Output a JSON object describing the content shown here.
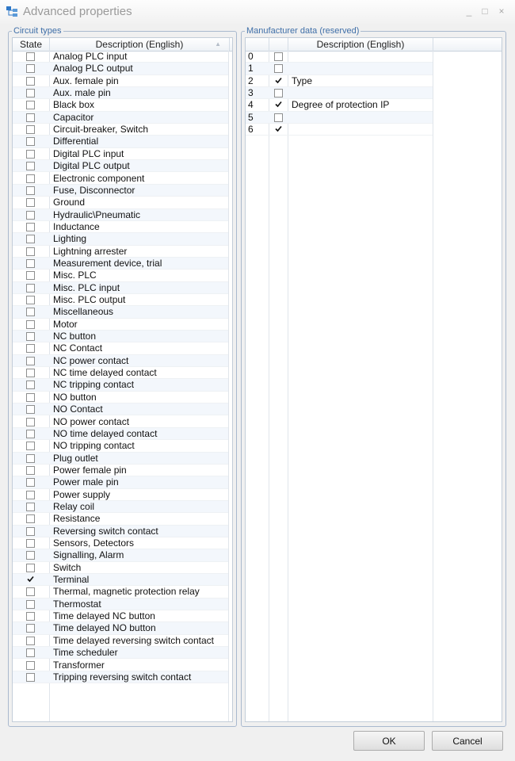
{
  "window": {
    "title": "Advanced properties",
    "minimize_glyph": "_",
    "maximize_glyph": "□",
    "close_glyph": "×"
  },
  "circuit_types": {
    "legend": "Circuit types",
    "col_state": "State",
    "col_description": "Description (English)",
    "sort_glyph": "▲",
    "items": [
      {
        "label": "Analog PLC input",
        "checked": false
      },
      {
        "label": "Analog PLC output",
        "checked": false
      },
      {
        "label": "Aux. female pin",
        "checked": false
      },
      {
        "label": "Aux. male pin",
        "checked": false
      },
      {
        "label": "Black box",
        "checked": false
      },
      {
        "label": "Capacitor",
        "checked": false
      },
      {
        "label": "Circuit-breaker, Switch",
        "checked": false
      },
      {
        "label": "Differential",
        "checked": false
      },
      {
        "label": "Digital PLC input",
        "checked": false
      },
      {
        "label": "Digital PLC output",
        "checked": false
      },
      {
        "label": "Electronic component",
        "checked": false
      },
      {
        "label": "Fuse, Disconnector",
        "checked": false
      },
      {
        "label": "Ground",
        "checked": false
      },
      {
        "label": "Hydraulic\\Pneumatic",
        "checked": false
      },
      {
        "label": "Inductance",
        "checked": false
      },
      {
        "label": "Lighting",
        "checked": false
      },
      {
        "label": "Lightning arrester",
        "checked": false
      },
      {
        "label": "Measurement device, trial",
        "checked": false
      },
      {
        "label": "Misc. PLC",
        "checked": false
      },
      {
        "label": "Misc. PLC input",
        "checked": false
      },
      {
        "label": "Misc. PLC output",
        "checked": false
      },
      {
        "label": "Miscellaneous",
        "checked": false
      },
      {
        "label": "Motor",
        "checked": false
      },
      {
        "label": "NC button",
        "checked": false
      },
      {
        "label": "NC Contact",
        "checked": false
      },
      {
        "label": "NC power contact",
        "checked": false
      },
      {
        "label": "NC time delayed contact",
        "checked": false
      },
      {
        "label": "NC tripping contact",
        "checked": false
      },
      {
        "label": "NO button",
        "checked": false
      },
      {
        "label": "NO Contact",
        "checked": false
      },
      {
        "label": "NO power contact",
        "checked": false
      },
      {
        "label": "NO time delayed contact",
        "checked": false
      },
      {
        "label": "NO tripping contact",
        "checked": false
      },
      {
        "label": "Plug outlet",
        "checked": false
      },
      {
        "label": "Power female pin",
        "checked": false
      },
      {
        "label": "Power male pin",
        "checked": false
      },
      {
        "label": "Power supply",
        "checked": false
      },
      {
        "label": "Relay coil",
        "checked": false
      },
      {
        "label": "Resistance",
        "checked": false
      },
      {
        "label": "Reversing switch contact",
        "checked": false
      },
      {
        "label": "Sensors, Detectors",
        "checked": false
      },
      {
        "label": "Signalling, Alarm",
        "checked": false
      },
      {
        "label": "Switch",
        "checked": false
      },
      {
        "label": "Terminal",
        "checked": true
      },
      {
        "label": "Thermal, magnetic protection relay",
        "checked": false
      },
      {
        "label": "Thermostat",
        "checked": false
      },
      {
        "label": "Time delayed NC button",
        "checked": false
      },
      {
        "label": "Time delayed NO button",
        "checked": false
      },
      {
        "label": "Time delayed reversing switch contact",
        "checked": false
      },
      {
        "label": "Time scheduler",
        "checked": false
      },
      {
        "label": "Transformer",
        "checked": false
      },
      {
        "label": "Tripping reversing switch contact",
        "checked": false
      }
    ]
  },
  "manufacturer_data": {
    "legend": "Manufacturer data (reserved)",
    "col_description": "Description (English)",
    "items": [
      {
        "index": "0",
        "checked": false,
        "label": ""
      },
      {
        "index": "1",
        "checked": false,
        "label": ""
      },
      {
        "index": "2",
        "checked": true,
        "label": "Type"
      },
      {
        "index": "3",
        "checked": false,
        "label": ""
      },
      {
        "index": "4",
        "checked": true,
        "label": "Degree of protection IP"
      },
      {
        "index": "5",
        "checked": false,
        "label": ""
      },
      {
        "index": "6",
        "checked": true,
        "label": ""
      }
    ]
  },
  "buttons": {
    "ok": "OK",
    "cancel": "Cancel"
  },
  "colors": {
    "legend_text": "#3f6fa8",
    "group_border": "#a9b9ce",
    "row_alt": "#f3f7fc"
  }
}
